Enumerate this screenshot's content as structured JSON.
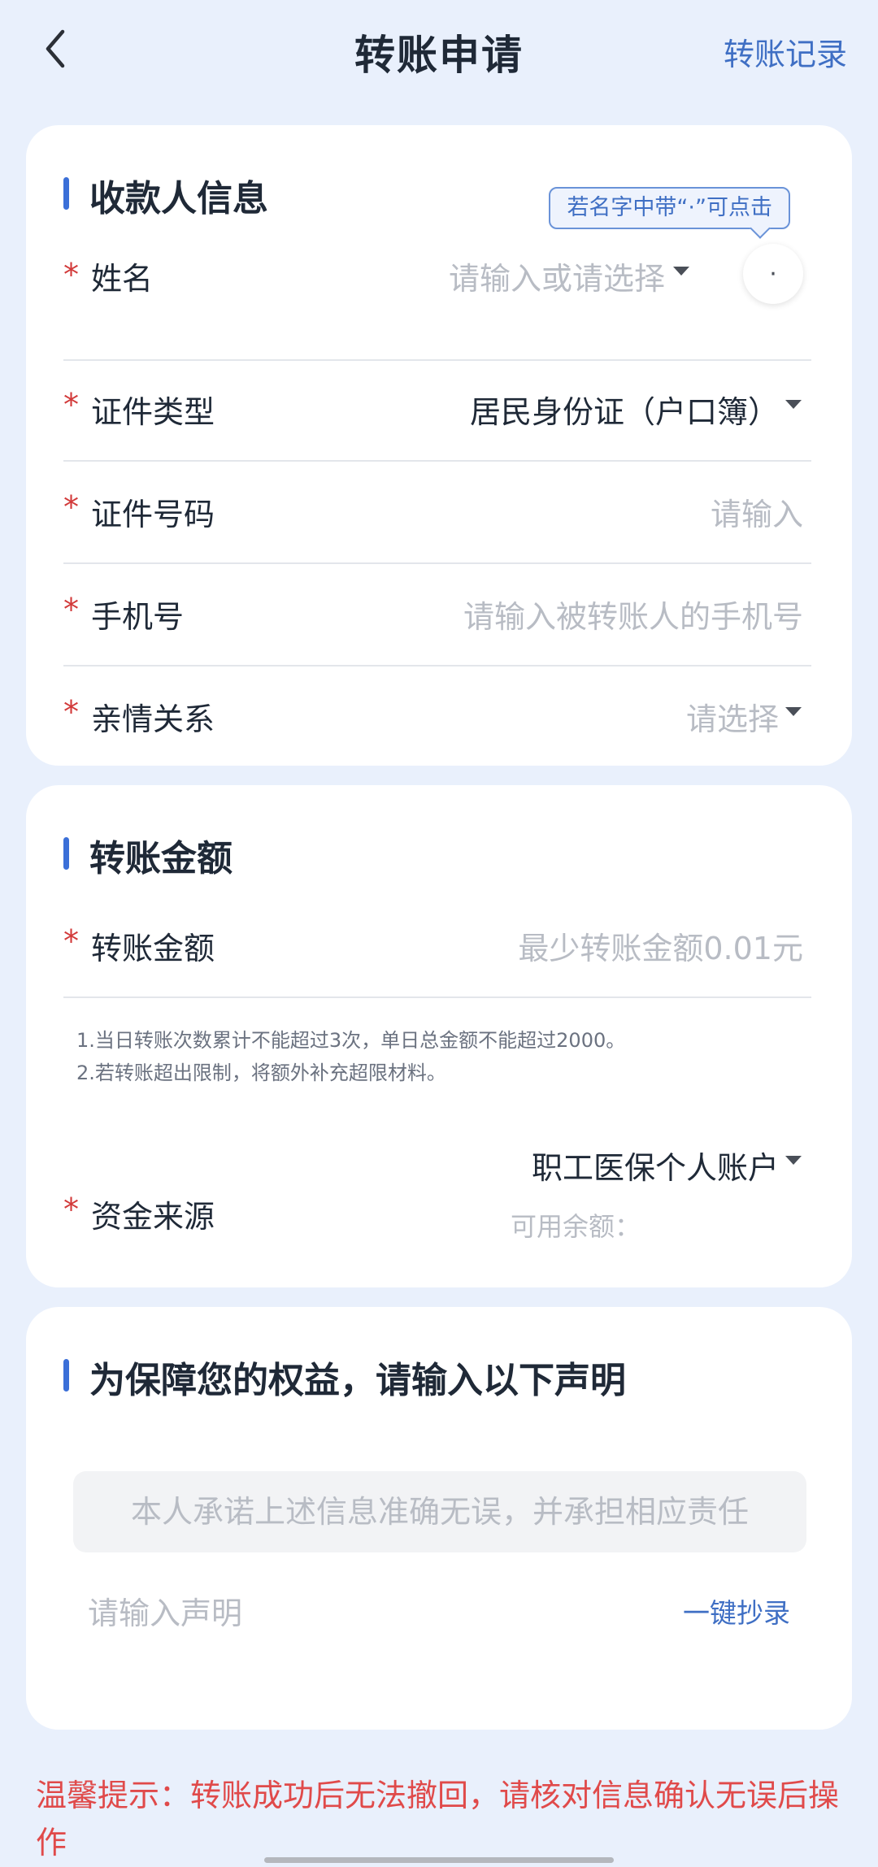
{
  "nav": {
    "title": "转账申请",
    "records": "转账记录",
    "back_icon": "chevron-left-icon"
  },
  "payee": {
    "section_title": "收款人信息",
    "name_tip": "若名字中带“·”可点击",
    "dot_button": "·",
    "fields": [
      {
        "label": "姓名",
        "value": "请输入或请选择",
        "required": "*"
      },
      {
        "label": "证件类型",
        "value": "居民身份证（户口簿）",
        "required": "*"
      },
      {
        "label": "证件号码",
        "value": "请输入",
        "required": "*"
      },
      {
        "label": "手机号",
        "value": "请输入被转账人的手机号",
        "required": "*"
      },
      {
        "label": "亲情关系",
        "value": "请选择",
        "required": "*"
      }
    ]
  },
  "amount": {
    "section_title": "转账金额",
    "amount_label": "转账金额",
    "amount_placeholder": "最少转账金额0.01元",
    "note1": "1.当日转账次数累计不能超过3次，单日总金额不能超过2000。",
    "note2": "2.若转账超出限制，将额外补充超限材料。",
    "source_label": "资金来源",
    "source_value": "职工医保个人账户",
    "balance_label": "可用余额：",
    "required": "*"
  },
  "statement": {
    "section_title": "为保障您的权益，请输入以下声明",
    "statement_text": "本人承诺上述信息准确无误，并承担相应责任",
    "input_placeholder": "请输入声明",
    "copy_button": "一键抄录"
  },
  "warm_tip": "温馨提示：转账成功后无法撤回，请核对信息确认无误后操作",
  "colors": {
    "background": "#e9f0fc",
    "accent": "#3f6fc4",
    "required": "#d23a3a",
    "warning": "#e04a4a"
  }
}
